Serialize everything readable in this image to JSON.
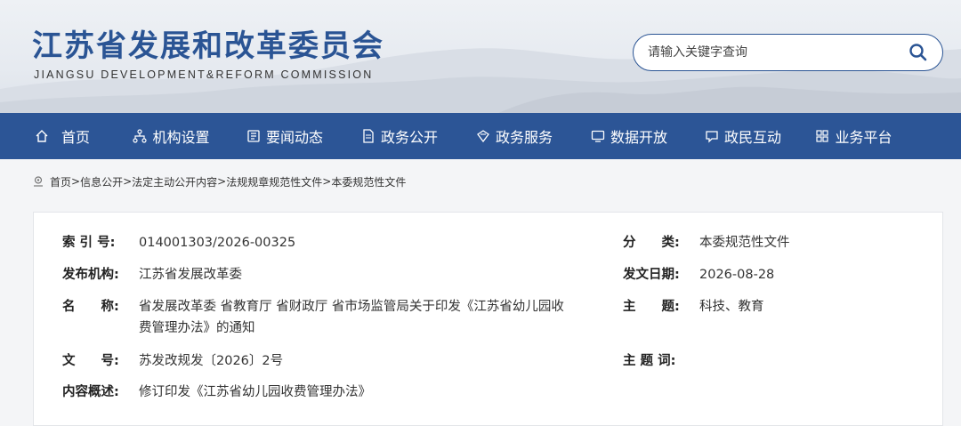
{
  "site": {
    "title_cn": "江苏省发展和改革委员会",
    "title_en": "JIANGSU DEVELOPMENT&REFORM COMMISSION"
  },
  "search": {
    "placeholder": "请输入关键字查询",
    "value": ""
  },
  "nav": [
    {
      "label": "首页",
      "icon": "home-icon"
    },
    {
      "label": "机构设置",
      "icon": "org-chart-icon"
    },
    {
      "label": "要闻动态",
      "icon": "news-icon"
    },
    {
      "label": "政务公开",
      "icon": "document-icon"
    },
    {
      "label": "政务服务",
      "icon": "service-icon"
    },
    {
      "label": "数据开放",
      "icon": "monitor-icon"
    },
    {
      "label": "政民互动",
      "icon": "chat-icon"
    },
    {
      "label": "业务平台",
      "icon": "grid-icon"
    }
  ],
  "breadcrumb": [
    {
      "label": "首页"
    },
    {
      "label": "信息公开"
    },
    {
      "label": "法定主动公开内容"
    },
    {
      "label": "法规规章规范性文件"
    },
    {
      "label": "本委规范性文件"
    }
  ],
  "breadcrumb_sep": ">",
  "meta": {
    "index_label": "索 引 号:",
    "index_value": "014001303/2026-00325",
    "category_label": "分　　类:",
    "category_value": "本委规范性文件",
    "publisher_label": "发布机构:",
    "publisher_value": "江苏省发展改革委",
    "date_label": "发文日期:",
    "date_value": "2026-08-28",
    "name_label": "名　　称:",
    "name_value_line1": "省发展改革委 省教育厅 省财政厅 省市场监管局关于印发《江苏省幼儿园收",
    "name_value_line2": "费管理办法》的通知",
    "topic_label": "主　　题:",
    "topic_value": "科技、教育",
    "docno_label": "文　　号:",
    "docno_value": "苏发改规发〔2026〕2号",
    "keywords_label": "主 题 词:",
    "keywords_value": "",
    "summary_label": "内容概述:",
    "summary_value": "修订印发《江苏省幼儿园收费管理办法》"
  },
  "colors": {
    "brand": "#2c5596",
    "title": "#2a5494"
  }
}
